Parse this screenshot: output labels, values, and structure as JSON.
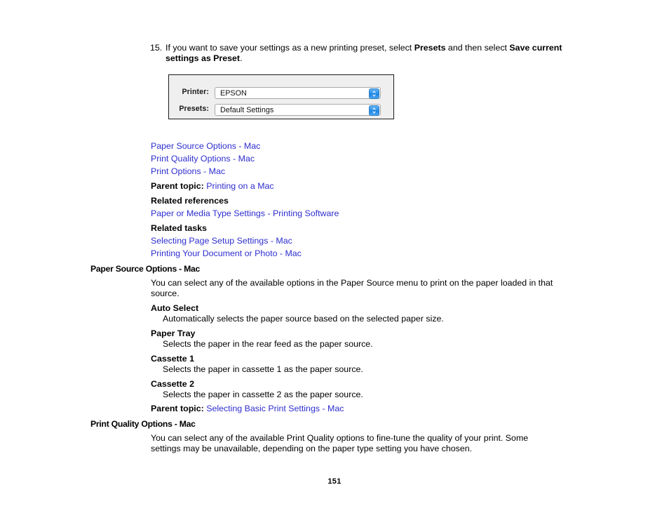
{
  "step": {
    "number": "15.",
    "text_before": "If you want to save your settings as a new printing preset, select ",
    "bold_1": "Presets",
    "text_middle": " and then select ",
    "bold_2": "Save current settings as Preset",
    "text_after": "."
  },
  "figure": {
    "alt": "Mac print dialog showing Printer and Presets pop-up menus",
    "rows": [
      {
        "label": "Printer:",
        "value": "EPSON",
        "stepper_icon": "up-down-chevron-icon"
      },
      {
        "label": "Presets:",
        "value": "Default Settings",
        "stepper_icon": "up-down-chevron-icon"
      }
    ]
  },
  "links_top": [
    "Paper Source Options - Mac",
    "Print Quality Options - Mac",
    "Print Options - Mac"
  ],
  "parent_topic_1": {
    "label": "Parent topic:",
    "link": "Printing on a Mac"
  },
  "related_references": {
    "heading": "Related references",
    "links": [
      "Paper or Media Type Settings - Printing Software"
    ]
  },
  "related_tasks": {
    "heading": "Related tasks",
    "links": [
      "Selecting Page Setup Settings - Mac",
      "Printing Your Document or Photo - Mac"
    ]
  },
  "section_paper_source": {
    "heading": "Paper Source Options - Mac",
    "intro": "You can select any of the available options in the Paper Source menu to print on the paper loaded in that source.",
    "definitions": [
      {
        "term": "Auto Select",
        "desc": "Automatically selects the paper source based on the selected paper size."
      },
      {
        "term": "Paper Tray",
        "desc": "Selects the paper in the rear feed as the paper source."
      },
      {
        "term": "Cassette 1",
        "desc": "Selects the paper in cassette 1 as the paper source."
      },
      {
        "term": "Cassette 2",
        "desc": "Selects the paper in cassette 2 as the paper source."
      }
    ],
    "parent_topic": {
      "label": "Parent topic:",
      "link": "Selecting Basic Print Settings - Mac"
    }
  },
  "section_print_quality": {
    "heading": "Print Quality Options - Mac",
    "intro": "You can select any of the available Print Quality options to fine-tune the quality of your print. Some settings may be unavailable, depending on the paper type setting you have chosen."
  },
  "footer": {
    "page_number": "151"
  },
  "colors": {
    "link": "#2e2ed0",
    "text": "#000000",
    "figure_bg": "#efefef",
    "figure_border": "#1c1c1c",
    "stepper_blue": "#2a8fe8"
  }
}
